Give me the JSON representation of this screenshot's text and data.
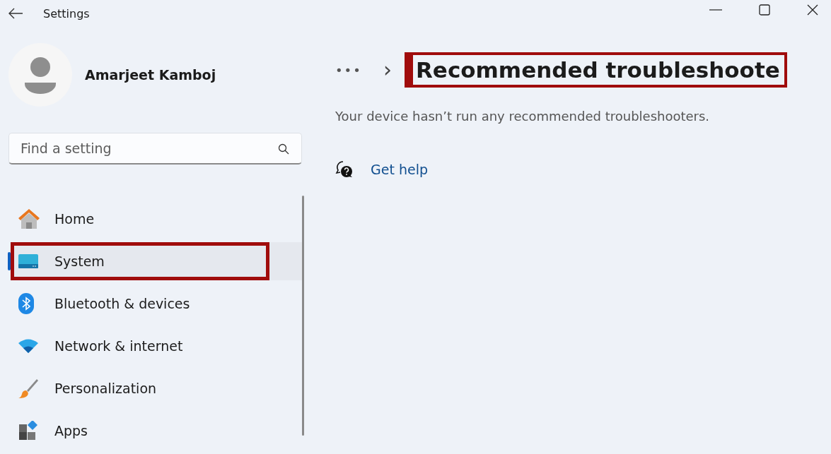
{
  "window": {
    "title": "Settings"
  },
  "user": {
    "name": "Amarjeet Kamboj"
  },
  "search": {
    "placeholder": "Find a setting"
  },
  "nav": [
    {
      "label": "Home",
      "kind": "home",
      "selected": false,
      "highlighted": false
    },
    {
      "label": "System",
      "kind": "system",
      "selected": true,
      "highlighted": true
    },
    {
      "label": "Bluetooth & devices",
      "kind": "bluetooth",
      "selected": false,
      "highlighted": false
    },
    {
      "label": "Network & internet",
      "kind": "network",
      "selected": false,
      "highlighted": false
    },
    {
      "label": "Personalization",
      "kind": "personalization",
      "selected": false,
      "highlighted": false
    },
    {
      "label": "Apps",
      "kind": "apps",
      "selected": false,
      "highlighted": false
    }
  ],
  "breadcrumb": {
    "more": "•••",
    "separator": "›"
  },
  "page": {
    "title": "Recommended troubleshoote",
    "title_highlighted": true,
    "message": "Your device hasn’t run any recommended troubleshooters.",
    "help_link": "Get help"
  }
}
